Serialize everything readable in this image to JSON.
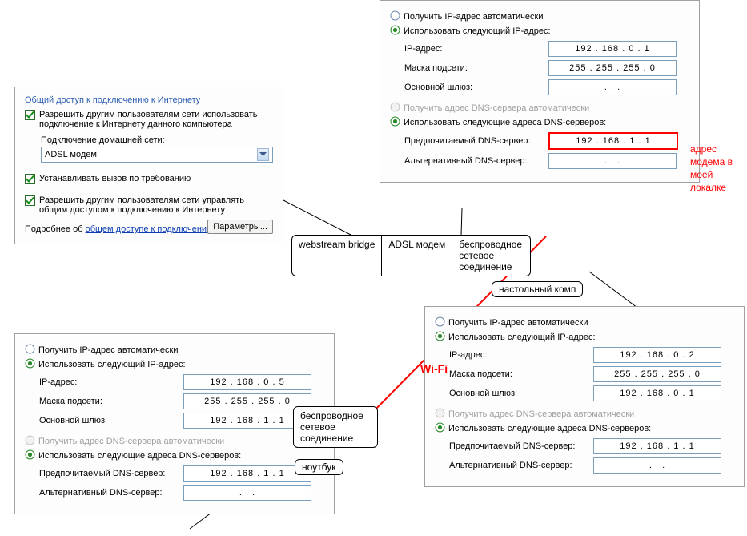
{
  "ics": {
    "title": "Общий доступ к подключению к Интернету",
    "share_check": "Разрешить другим пользователям сети использовать подключение к Интернету данного компьютера",
    "home_net_label": "Подключение домашней сети:",
    "home_net_value": "ADSL модем",
    "dial_on_demand": "Устанавливать вызов по требованию",
    "allow_control": "Разрешить другим пользователям сети управлять общим доступом к подключению к Интернету",
    "more_prefix": "Подробнее об ",
    "more_link": "общем доступе к подключению к Интернету",
    "more_suffix": ".",
    "params_btn": "Параметры..."
  },
  "tcp_labels": {
    "auto_ip": "Получить IP-адрес автоматически",
    "manual_ip": "Использовать следующий IP-адрес:",
    "ip": "IP-адрес:",
    "mask": "Маска подсети:",
    "gw": "Основной шлюз:",
    "auto_dns": "Получить адрес DNS-сервера автоматически",
    "manual_dns": "Использовать следующие адреса DNS-серверов:",
    "dns1": "Предпочитаемый DNS-сервер:",
    "dns2": "Альтернативный DNS-сервер:"
  },
  "tcp1": {
    "ip": "192 . 168 .   0  .   1",
    "mask": "255 . 255 . 255 .   0",
    "gw": ".          .          .",
    "dns1": "192 . 168 .   1  .   1",
    "dns2": ".          .          ."
  },
  "tcp2": {
    "ip": "192 . 168 .   0  .   2",
    "mask": "255 . 255 . 255 .   0",
    "gw": "192 . 168 .   0  .   1",
    "dns1": "192 . 168 .   1  .   1",
    "dns2": ".          .          ."
  },
  "tcp3": {
    "ip": "192 . 168 .   0  .   5",
    "mask": "255 . 255 . 255 .   0",
    "gw": "192 . 168 .   1  .   1",
    "dns1": "192 . 168 .   1  .   1",
    "dns2": ".          .          ."
  },
  "nodes": {
    "webstream": "webstream bridge",
    "adsl": "ADSL модем",
    "wireless": "беспроводное\nсетевое\nсоединение",
    "desktop": "настольный комп",
    "laptop": "ноутбук",
    "wifi": "Wi-Fi"
  },
  "note": "адрес\nмодема в\nмоей\nлокалке"
}
